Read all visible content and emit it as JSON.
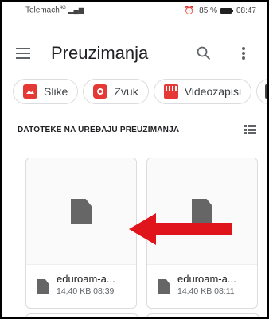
{
  "statusbar": {
    "carrier": "Telemach",
    "signal_text": "4G",
    "right_text": "85 %",
    "time": "08:47"
  },
  "appbar": {
    "title": "Preuzimanja"
  },
  "chips": [
    {
      "label": "Slike",
      "icon": "image-icon"
    },
    {
      "label": "Zvuk",
      "icon": "audio-icon"
    },
    {
      "label": "Videozapisi",
      "icon": "video-icon"
    },
    {
      "label": "",
      "icon": "document-icon"
    }
  ],
  "section": {
    "title": "DATOTEKE NA UREĐAJU PREUZIMANJA"
  },
  "files": [
    {
      "name": "eduroam-a...",
      "size": "14,40 KB",
      "time": "08:39"
    },
    {
      "name": "eduroam-a...",
      "size": "14,40 KB",
      "time": "08:11"
    }
  ]
}
